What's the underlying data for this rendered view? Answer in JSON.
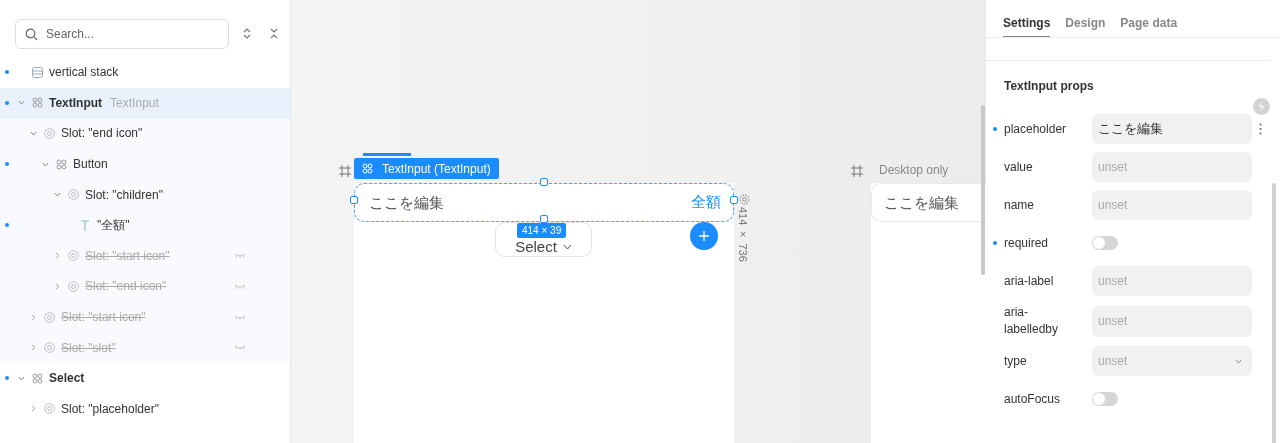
{
  "search": {
    "placeholder": "Search..."
  },
  "tree": [
    {
      "label": "vertical stack",
      "kind": "stack",
      "modified": true,
      "selected": false,
      "hidden": false
    },
    {
      "label": "TextInput",
      "sublabel": "TextInput",
      "kind": "component",
      "modified": true,
      "selected": true,
      "hidden": false,
      "expanded": true,
      "children": [
        {
          "label": "Slot: \"end icon\"",
          "kind": "slot",
          "modified": false,
          "selected": false,
          "hidden": false,
          "expanded": true,
          "children": [
            {
              "label": "Button",
              "kind": "component",
              "modified": true,
              "selected": false,
              "hidden": false,
              "expanded": true,
              "children": [
                {
                  "label": "Slot: \"children\"",
                  "kind": "slot",
                  "modified": false,
                  "selected": false,
                  "hidden": false,
                  "expanded": true,
                  "children": [
                    {
                      "label": "\"全額\"",
                      "kind": "text",
                      "modified": true,
                      "selected": false,
                      "hidden": false
                    }
                  ]
                },
                {
                  "label": "Slot: \"start icon\"",
                  "kind": "slot",
                  "modified": false,
                  "selected": false,
                  "hidden": true,
                  "expanded": false
                },
                {
                  "label": "Slot: \"end icon\"",
                  "kind": "slot",
                  "modified": false,
                  "selected": false,
                  "hidden": true,
                  "expanded": false
                }
              ]
            }
          ]
        },
        {
          "label": "Slot: \"start icon\"",
          "kind": "slot",
          "modified": false,
          "selected": false,
          "hidden": true,
          "expanded": false
        },
        {
          "label": "Slot: \"slot\"",
          "kind": "slot",
          "modified": false,
          "selected": false,
          "hidden": true,
          "expanded": false
        }
      ]
    },
    {
      "label": "Select",
      "kind": "component",
      "modified": true,
      "selected": false,
      "hidden": false,
      "expanded": true,
      "children": [
        {
          "label": "Slot: \"placeholder\"",
          "kind": "slot",
          "modified": false,
          "selected": false,
          "hidden": false,
          "expanded": false
        }
      ]
    }
  ],
  "canvas": {
    "mobile": {
      "tag": "TextInput (TextInput)",
      "input_placeholder": "ここを編集",
      "end_button": "全額",
      "select": "Select",
      "size_badge": "414 × 39",
      "frame_size": "414 × 736"
    },
    "desktop": {
      "label": "Desktop only",
      "input_placeholder": "ここを編集"
    }
  },
  "panel": {
    "tabs": [
      {
        "label": "Settings",
        "selected": true
      },
      {
        "label": "Design",
        "selected": false
      },
      {
        "label": "Page data",
        "selected": false
      }
    ],
    "section_title": "TextInput props",
    "props": [
      {
        "label": "placeholder",
        "kind": "text",
        "value": "ここを編集",
        "modified": true
      },
      {
        "label": "value",
        "kind": "text",
        "placeholder": "unset",
        "modified": false
      },
      {
        "label": "name",
        "kind": "text",
        "placeholder": "unset",
        "modified": false
      },
      {
        "label": "required",
        "kind": "toggle",
        "on": false,
        "modified": true
      },
      {
        "label": "aria-label",
        "kind": "text",
        "placeholder": "unset",
        "modified": false
      },
      {
        "label": "aria-labelledby",
        "kind": "text",
        "placeholder": "unset",
        "modified": false
      },
      {
        "label": "type",
        "kind": "select",
        "value": "unset",
        "modified": false
      },
      {
        "label": "autoFocus",
        "kind": "toggle",
        "on": false,
        "modified": false
      }
    ]
  }
}
